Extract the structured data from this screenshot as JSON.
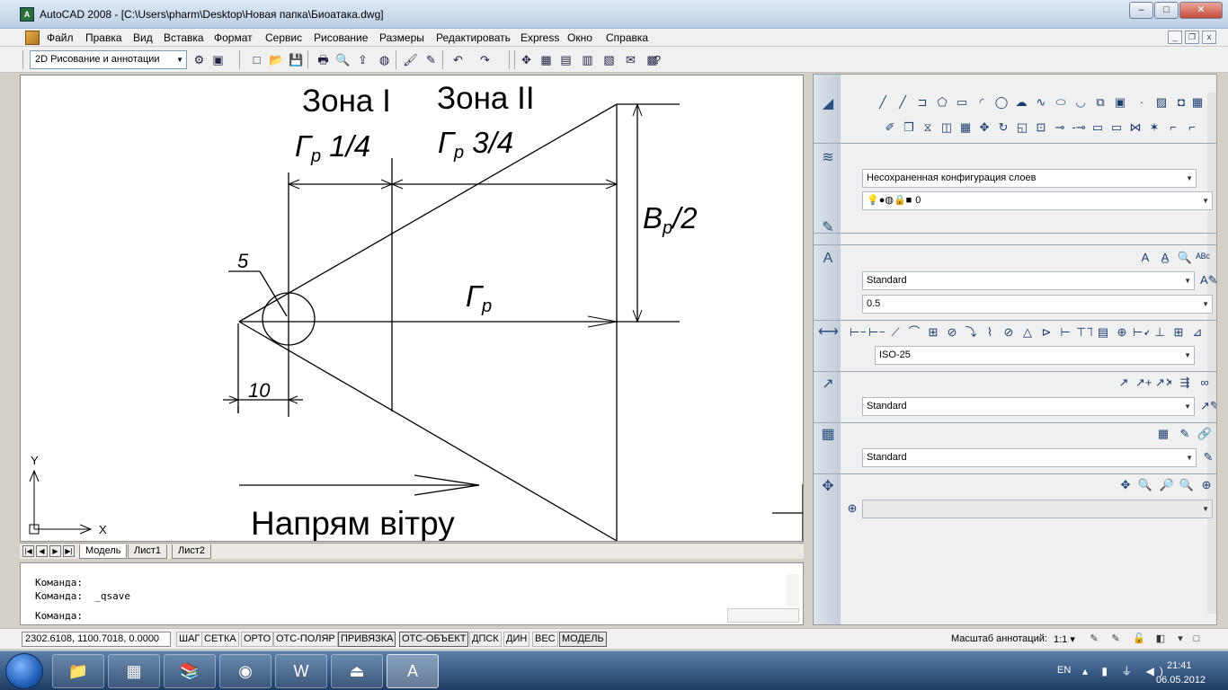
{
  "window": {
    "title": "AutoCAD 2008 - [C:\\Users\\pharm\\Desktop\\Новая папка\\Биоатака.dwg]",
    "app_icon_text": "A",
    "minimize_glyph": "–",
    "maximize_glyph": "□",
    "close_glyph": "✕"
  },
  "menu": {
    "items": [
      "Файл",
      "Правка",
      "Вид",
      "Вставка",
      "Формат",
      "Сервис",
      "Рисование",
      "Размеры",
      "Редактировать",
      "Express",
      "Окно",
      "Справка"
    ],
    "mdi_minimize": "_",
    "mdi_restore": "❐",
    "mdi_close": "x"
  },
  "toolbar": {
    "workspace": "2D Рисование и аннотации",
    "workspace_arrow": "▼",
    "icons": [
      "gear-icon",
      "workspace-settings-icon",
      "new-file-icon",
      "open-file-icon",
      "save-icon",
      "print-icon",
      "print-preview-icon",
      "publish-icon",
      "plot-icon",
      "match-properties-icon",
      "brush-icon",
      "undo-icon",
      "redo-icon",
      "pan-realtime-icon",
      "properties-icon",
      "design-center-icon",
      "tool-palettes-icon",
      "sheet-set-icon",
      "markup-icon",
      "calculator-icon",
      "help-icon"
    ],
    "glyphs": [
      "⚙",
      "▣",
      "□",
      "📂",
      "💾",
      "🖶",
      "🔍",
      "⇪",
      "◍",
      "🖌",
      "✎",
      "↶",
      "↷",
      "✥",
      "▦",
      "▤",
      "▥",
      "▧",
      "✉",
      "▩",
      "?"
    ]
  },
  "drawing": {
    "zone1_label": "Зона I",
    "zone2_label": "Зона II",
    "gr_quarter_main": "Г",
    "gr_quarter_sub": "р",
    "gr_quarter_frac": " 1/4",
    "gr_three_main": "Г",
    "gr_three_sub": "р",
    "gr_three_frac": " 3/4",
    "br_main": "В",
    "br_sub": "р",
    "br_frac": "/2",
    "gr_main": "Г",
    "gr_sub": "р",
    "label_five": "5",
    "label_ten": "10",
    "wind_label": "Напрям вітру",
    "ucs_x": "X",
    "ucs_y": "Y"
  },
  "layout_tabs": {
    "nav": [
      "|◀",
      "◀",
      "▶",
      "▶|"
    ],
    "tabs": [
      "Модель",
      "Лист1",
      "Лист2"
    ],
    "active": "Модель"
  },
  "command": {
    "history": [
      "Команда:",
      "Команда:  _qsave"
    ],
    "prompt": "Команда:",
    "input_value": ""
  },
  "palette": {
    "draw_icons": [
      "line-icon",
      "construction-line-icon",
      "polyline-icon",
      "polygon-icon",
      "rectangle-icon",
      "arc-icon",
      "circle-icon",
      "revision-cloud-icon",
      "spline-icon",
      "ellipse-icon",
      "ellipse-arc-icon",
      "insert-block-icon",
      "make-block-icon",
      "point-icon",
      "hatch-icon",
      "region-icon",
      "table-icon"
    ],
    "draw_glyphs": [
      "╱",
      "╱",
      "⊐",
      "⬠",
      "▭",
      "◜",
      "◯",
      "☁",
      "∿",
      "⬭",
      "◡",
      "⧉",
      "▣",
      "·",
      "▨",
      "◘",
      "▦"
    ],
    "modify_icons": [
      "erase-icon",
      "copy-icon",
      "mirror-icon",
      "offset-icon",
      "array-icon",
      "move-icon",
      "rotate-icon",
      "scale-icon",
      "stretch-icon",
      "trim-icon",
      "extend-icon",
      "break-icon",
      "join-icon",
      "chamfer-icon",
      "explode-icon",
      "fillet-icon",
      "chamfer-edge-icon"
    ],
    "modify_glyphs": [
      "✐",
      "❐",
      "⧖",
      "◫",
      "▦",
      "✥",
      "↻",
      "◱",
      "⊡",
      "⊸",
      "-⊸",
      "▭",
      "▭",
      "⋈",
      "✶",
      "⌐",
      "⌐"
    ],
    "layer_combo": "Несохраненная конфигурация слоев",
    "layer_state": "0",
    "layer_state_glyphs": "💡●◍🔒■",
    "text_style": "Standard",
    "text_height": "0.5",
    "dim_style": "ISO-25",
    "mleader_style": "Standard",
    "table_style": "Standard",
    "combo_arrow": "▼",
    "panel_icons": [
      "draw-panel-icon",
      "layers-panel-icon",
      "layer-tools-icon",
      "text-panel-icon",
      "dimension-panel-icon",
      "multileader-panel-icon",
      "table-panel-icon",
      "navigation-panel-icon"
    ],
    "panel_glyphs": [
      "◢",
      "≋",
      "✎",
      "A",
      "⟷",
      "↗",
      "▦",
      "✥"
    ],
    "text_icons_glyphs": [
      "A",
      "A̲",
      "🔍",
      "ᴬᴮᶜ",
      "A✎"
    ],
    "dim_glyphs": [
      "⊢⊣",
      "⊢⊣",
      "⟋",
      "⌒",
      "⊞",
      "⊘",
      "⤵",
      "⌇",
      "⊘",
      "△",
      "⊳",
      "⊢",
      "⊤⊤",
      "▤",
      "⊕",
      "⊢✓",
      "⊥",
      "⊞",
      "⊿"
    ],
    "leader_glyphs": [
      "↗",
      "↗+",
      "↗✕",
      "⇶",
      "∞",
      "↗✎"
    ],
    "table_glyphs": [
      "▦",
      "✎",
      "🔗",
      "✎"
    ],
    "nav_glyphs": [
      "✥",
      "🔍",
      "🔎",
      "🔍",
      "⊕"
    ],
    "viewport_back": "⊕"
  },
  "statusbar": {
    "coords": "2302.6108, 1100.7018, 0.0000",
    "toggles": [
      "ШАГ",
      "СЕТКА",
      "ОРТО",
      "ОТС-ПОЛЯР",
      "ПРИВЯЗКА",
      "ОТС-ОБЪЕКТ",
      "ДПСК",
      "ДИН",
      "ВЕС",
      "МОДЕЛЬ"
    ],
    "toggle_on": [
      "ПРИВЯЗКА",
      "ОТС-ОБЪЕКТ",
      "МОДЕЛЬ"
    ],
    "anno_label": "Масштаб аннотаций:",
    "anno_value": "1:1 ▾",
    "tray_glyphs": [
      "✎",
      "✎",
      "🔓",
      "◧",
      "▾",
      "□"
    ]
  },
  "taskbar": {
    "apps": [
      "explorer-icon",
      "calculator-icon",
      "library-icon",
      "firefox-icon",
      "word-icon",
      "acrobat-icon",
      "autocad-icon"
    ],
    "app_glyphs": [
      "📁",
      "▦",
      "📚",
      "◉",
      "W",
      "⏏",
      "A"
    ],
    "lang": "EN",
    "tray": "▴ ▮ ⏚ ◀)",
    "time": "21:41",
    "date": "06.05.2012"
  }
}
